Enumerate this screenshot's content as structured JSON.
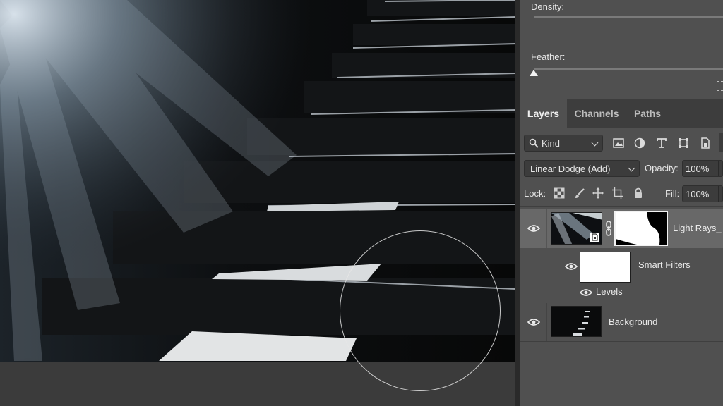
{
  "properties": {
    "density_label": "Density:",
    "feather_label": "Feather:",
    "density_value": 1.0,
    "feather_value": 0.0
  },
  "tabs": [
    {
      "label": "Layers",
      "active": true
    },
    {
      "label": "Channels",
      "active": false
    },
    {
      "label": "Paths",
      "active": false
    }
  ],
  "filter": {
    "kind_label": "Kind",
    "icons": [
      "image-filter-icon",
      "adjustment-filter-icon",
      "type-filter-icon",
      "shape-filter-icon",
      "smart-object-filter-icon"
    ]
  },
  "blend": {
    "mode": "Linear Dodge (Add)",
    "opacity_label": "Opacity:",
    "opacity_value": "100%"
  },
  "lock": {
    "label": "Lock:",
    "fill_label": "Fill:",
    "fill_value": "100%",
    "icons": [
      "lock-transparent-pixels-icon",
      "lock-image-pixels-icon",
      "lock-position-icon",
      "lock-artboard-icon",
      "lock-all-icon"
    ]
  },
  "layers": [
    {
      "name": "Light Rays_",
      "visible": true,
      "selected": true,
      "smart_object": true,
      "has_mask": true
    },
    {
      "name": "Smart Filters",
      "visible": true,
      "type": "smart-filters"
    },
    {
      "name": "Levels",
      "visible": true,
      "type": "filter"
    },
    {
      "name": "Background",
      "visible": true,
      "selected": false
    }
  ],
  "colors": {
    "panel_bg": "#505050",
    "tab_bar_bg": "#3d3d3d",
    "selected_layer_bg": "#686868",
    "canvas_bg": "#3b3b3b"
  }
}
